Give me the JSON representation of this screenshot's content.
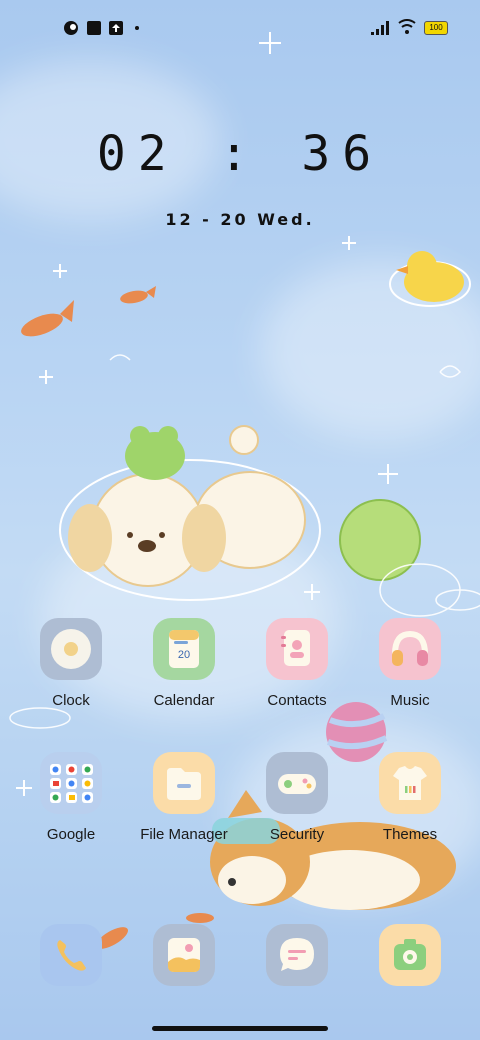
{
  "status_bar": {
    "left_icons": [
      "circle-app-icon",
      "square-app-icon",
      "upload-icon",
      "dot-icon"
    ],
    "battery": "100"
  },
  "lockclock": {
    "time": "02 : 36",
    "date": "12 - 20  Wed."
  },
  "apps": [
    {
      "label": "Clock",
      "icon": "clock-icon"
    },
    {
      "label": "Calendar",
      "icon": "calendar-icon",
      "day": "20"
    },
    {
      "label": "Contacts",
      "icon": "contacts-icon"
    },
    {
      "label": "Music",
      "icon": "headphones-icon"
    },
    {
      "label": "Google",
      "icon": "folder-icon"
    },
    {
      "label": "File Manager",
      "icon": "file-manager-icon"
    },
    {
      "label": "Security",
      "icon": "gamepad-icon"
    },
    {
      "label": "Themes",
      "icon": "tshirt-icon"
    }
  ],
  "dock": [
    {
      "icon": "phone-icon"
    },
    {
      "icon": "gallery-icon"
    },
    {
      "icon": "messages-icon"
    },
    {
      "icon": "camera-icon"
    }
  ]
}
